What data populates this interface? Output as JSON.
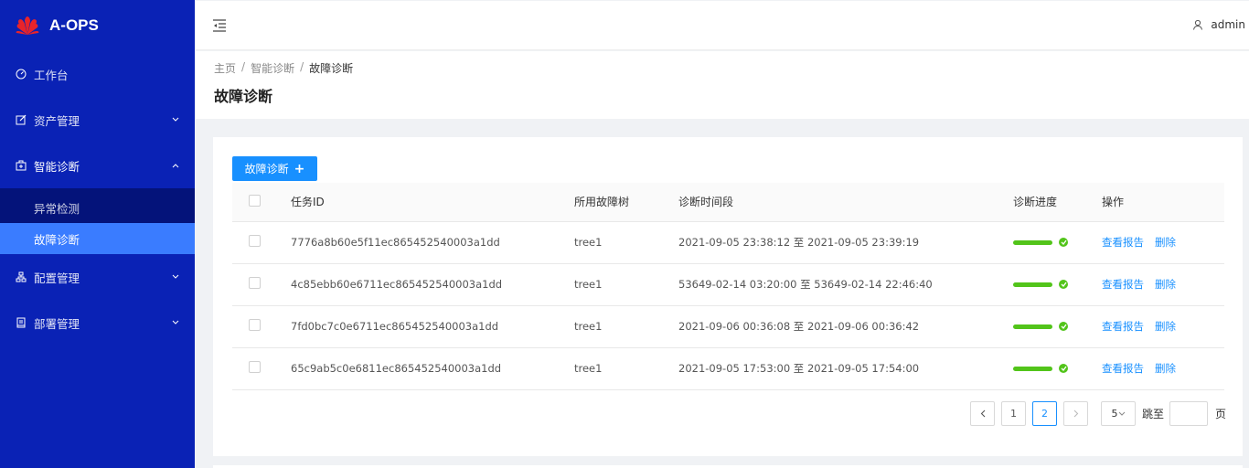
{
  "app": {
    "name": "A-OPS",
    "brand_color": "#0a22b5",
    "accent": "#1890ff",
    "success": "#52c41a"
  },
  "sidebar": {
    "items": [
      {
        "label": "工作台",
        "icon": "dashboard-icon"
      },
      {
        "label": "资产管理",
        "icon": "edit-icon",
        "expandable": true
      },
      {
        "label": "智能诊断",
        "icon": "diagnosis-icon",
        "expandable": true,
        "open": true,
        "children": [
          {
            "label": "异常检测"
          },
          {
            "label": "故障诊断",
            "active": true
          }
        ]
      },
      {
        "label": "配置管理",
        "icon": "config-icon",
        "expandable": true
      },
      {
        "label": "部署管理",
        "icon": "deploy-icon",
        "expandable": true
      }
    ]
  },
  "header": {
    "user": "admin"
  },
  "breadcrumb": [
    "主页",
    "智能诊断",
    "故障诊断"
  ],
  "page_title": "故障诊断",
  "toolbar": {
    "add_label": "故障诊断",
    "add_symbol": "+"
  },
  "table": {
    "columns": [
      "任务ID",
      "所用故障树",
      "诊断时间段",
      "诊断进度",
      "操作"
    ],
    "rows": [
      {
        "id": "7776a8b60e5f11ec865452540003a1dd",
        "tree": "tree1",
        "period": "2021-09-05 23:38:12 至 2021-09-05 23:39:19",
        "progress": 1.0
      },
      {
        "id": "4c85ebb60e6711ec865452540003a1dd",
        "tree": "tree1",
        "period": "53649-02-14 03:20:00 至 53649-02-14 22:46:40",
        "progress": 1.0
      },
      {
        "id": "7fd0bc7c0e6711ec865452540003a1dd",
        "tree": "tree1",
        "period": "2021-09-06 00:36:08 至 2021-09-06 00:36:42",
        "progress": 1.0
      },
      {
        "id": "65c9ab5c0e6811ec865452540003a1dd",
        "tree": "tree1",
        "period": "2021-09-05 17:53:00 至 2021-09-05 17:54:00",
        "progress": 1.0
      }
    ],
    "actions": {
      "view": "查看报告",
      "delete": "删除"
    }
  },
  "pagination": {
    "pages": [
      "1",
      "2"
    ],
    "current": "2",
    "page_size": "5",
    "jump_label": "跳至",
    "page_unit": "页"
  }
}
